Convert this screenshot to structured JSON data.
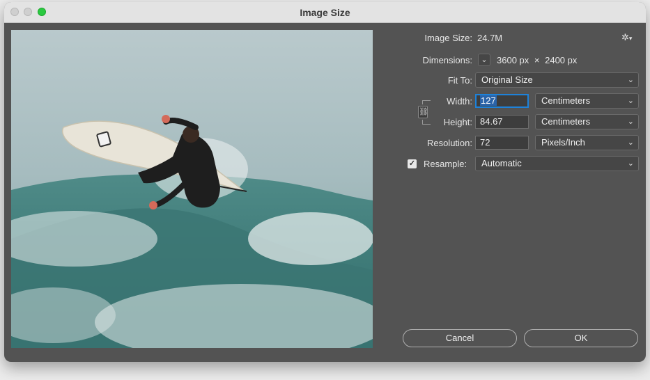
{
  "window": {
    "title": "Image Size"
  },
  "image_size": {
    "label": "Image Size:",
    "value": "24.7M"
  },
  "dimensions": {
    "label": "Dimensions:",
    "width": "3600 px",
    "times": "×",
    "height": "2400 px"
  },
  "fit_to": {
    "label": "Fit To:",
    "value": "Original Size"
  },
  "width": {
    "label": "Width:",
    "value": "127",
    "unit": "Centimeters"
  },
  "height": {
    "label": "Height:",
    "value": "84.67",
    "unit": "Centimeters"
  },
  "resolution": {
    "label": "Resolution:",
    "value": "72",
    "unit": "Pixels/Inch"
  },
  "resample": {
    "label": "Resample:",
    "checked": true,
    "value": "Automatic"
  },
  "buttons": {
    "cancel": "Cancel",
    "ok": "OK"
  },
  "icons": {
    "gear": "gear-icon",
    "chain": "chain-link-icon",
    "chevron": "chevron-down-icon",
    "check": "checkmark-icon"
  },
  "colors": {
    "dialog_bg": "#535353",
    "focus_ring": "#1e82d9",
    "zoom_light": "#2ac940"
  }
}
